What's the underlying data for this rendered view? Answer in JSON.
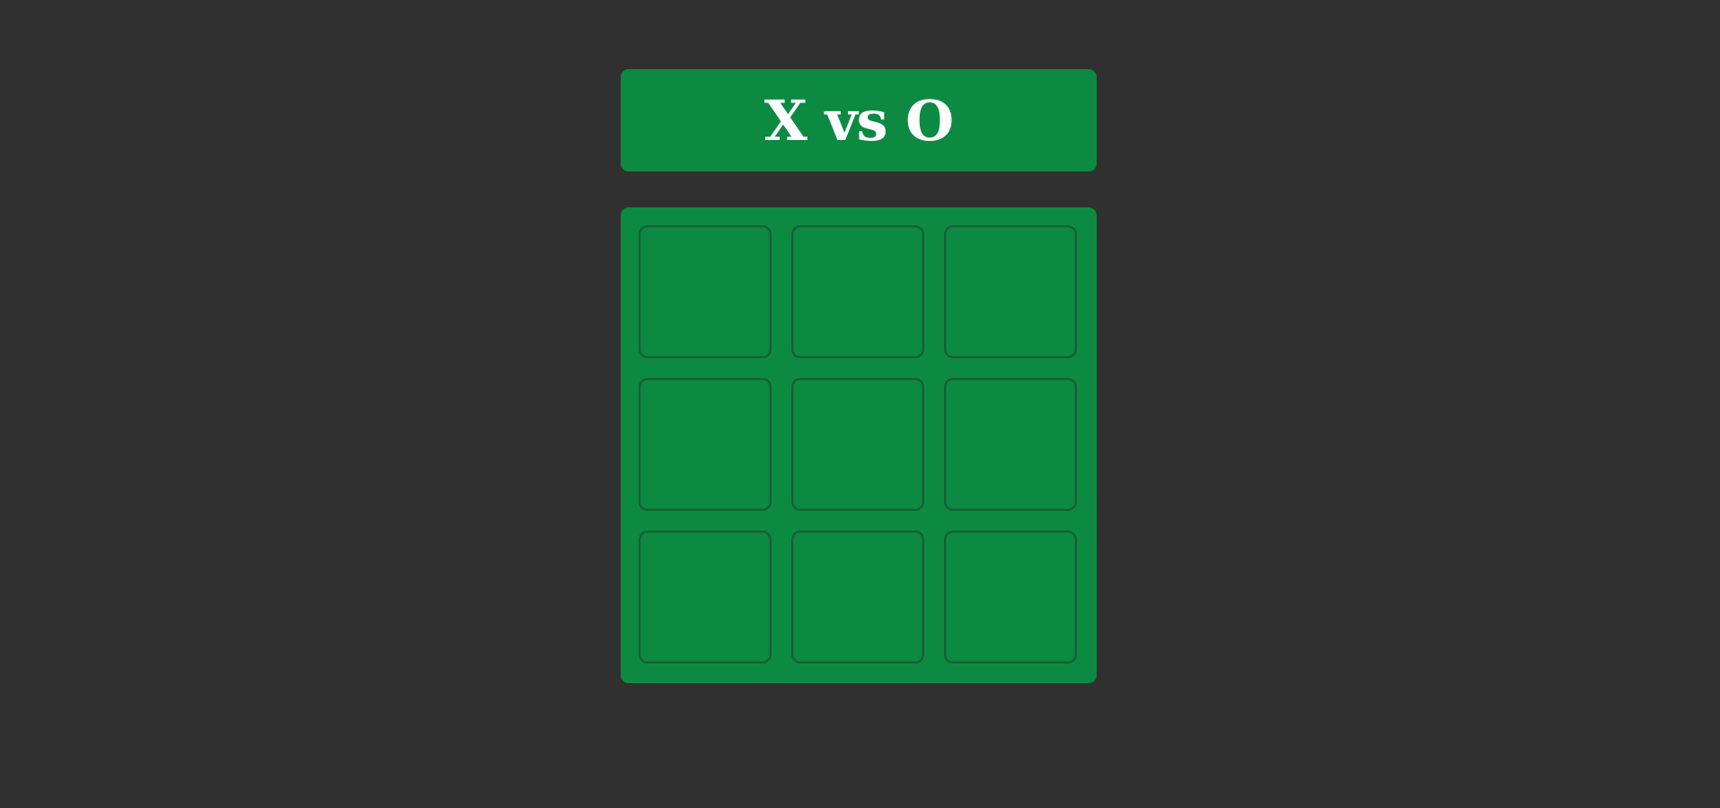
{
  "header": {
    "title": "X vs O"
  },
  "board": {
    "cells": [
      "",
      "",
      "",
      "",
      "",
      "",
      "",
      "",
      ""
    ]
  },
  "colors": {
    "background": "#303030",
    "accent": "#0c8a42",
    "cell_border": "#1f5a36",
    "text": "#ffffff"
  }
}
